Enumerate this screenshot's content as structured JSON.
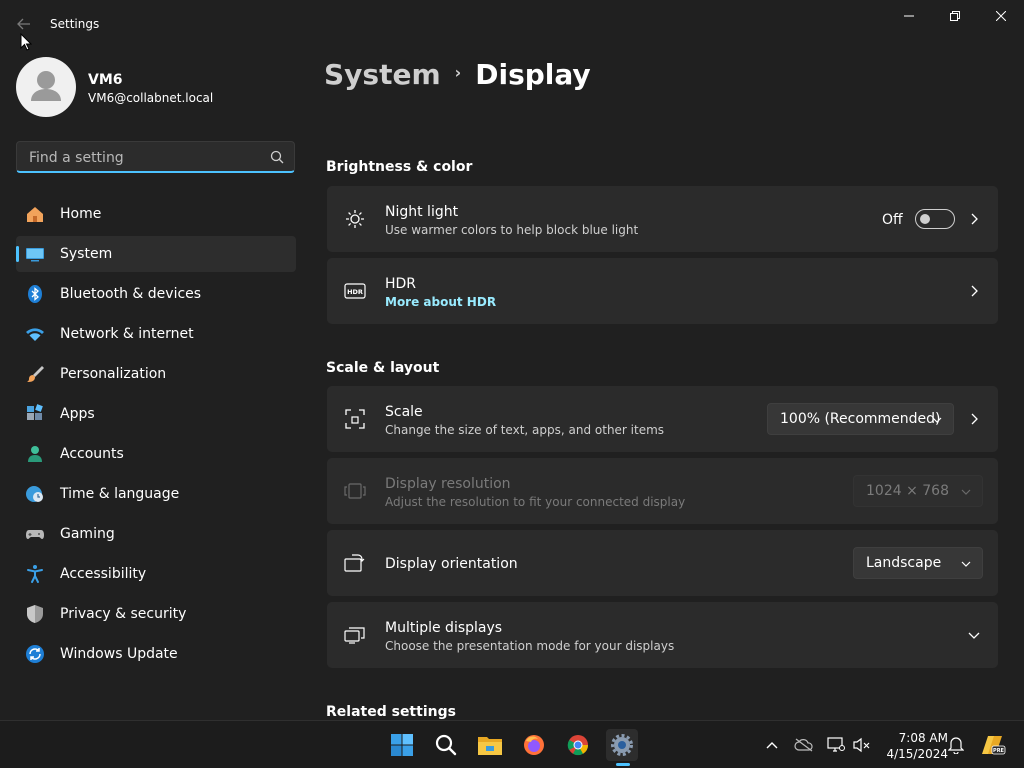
{
  "window": {
    "title": "Settings"
  },
  "user": {
    "name": "VM6",
    "email": "VM6@collabnet.local"
  },
  "search": {
    "placeholder": "Find a setting"
  },
  "nav": [
    {
      "label": "Home",
      "icon": "home-icon"
    },
    {
      "label": "System",
      "icon": "system-icon",
      "active": true
    },
    {
      "label": "Bluetooth & devices",
      "icon": "bluetooth-icon"
    },
    {
      "label": "Network & internet",
      "icon": "network-icon"
    },
    {
      "label": "Personalization",
      "icon": "brush-icon"
    },
    {
      "label": "Apps",
      "icon": "apps-icon"
    },
    {
      "label": "Accounts",
      "icon": "accounts-icon"
    },
    {
      "label": "Time & language",
      "icon": "clock-globe-icon"
    },
    {
      "label": "Gaming",
      "icon": "gamepad-icon"
    },
    {
      "label": "Accessibility",
      "icon": "accessibility-icon"
    },
    {
      "label": "Privacy & security",
      "icon": "shield-icon"
    },
    {
      "label": "Windows Update",
      "icon": "update-icon"
    }
  ],
  "breadcrumb": {
    "parent": "System",
    "separator": "›",
    "current": "Display"
  },
  "sections": {
    "brightness": "Brightness & color",
    "scale_layout": "Scale & layout",
    "related": "Related settings"
  },
  "night_light": {
    "title": "Night light",
    "subtitle": "Use warmer colors to help block blue light",
    "state": "Off"
  },
  "hdr": {
    "title": "HDR",
    "link": "More about HDR"
  },
  "scale": {
    "title": "Scale",
    "subtitle": "Change the size of text, apps, and other items",
    "value": "100% (Recommended)"
  },
  "resolution": {
    "title": "Display resolution",
    "subtitle": "Adjust the resolution to fit your connected display",
    "value": "1024 × 768"
  },
  "orientation": {
    "title": "Display orientation",
    "value": "Landscape"
  },
  "multiple_displays": {
    "title": "Multiple displays",
    "subtitle": "Choose the presentation mode for your displays"
  },
  "taskbar": {
    "time": "7:08 AM",
    "date": "4/15/2024",
    "apps": [
      "start-icon",
      "search-icon",
      "file-explorer-icon",
      "firefox-icon",
      "chrome-icon",
      "settings-icon"
    ]
  },
  "colors": {
    "accent": "#4cc2ff",
    "link": "#99ebff",
    "background": "#202020",
    "card": "#2b2b2b"
  }
}
